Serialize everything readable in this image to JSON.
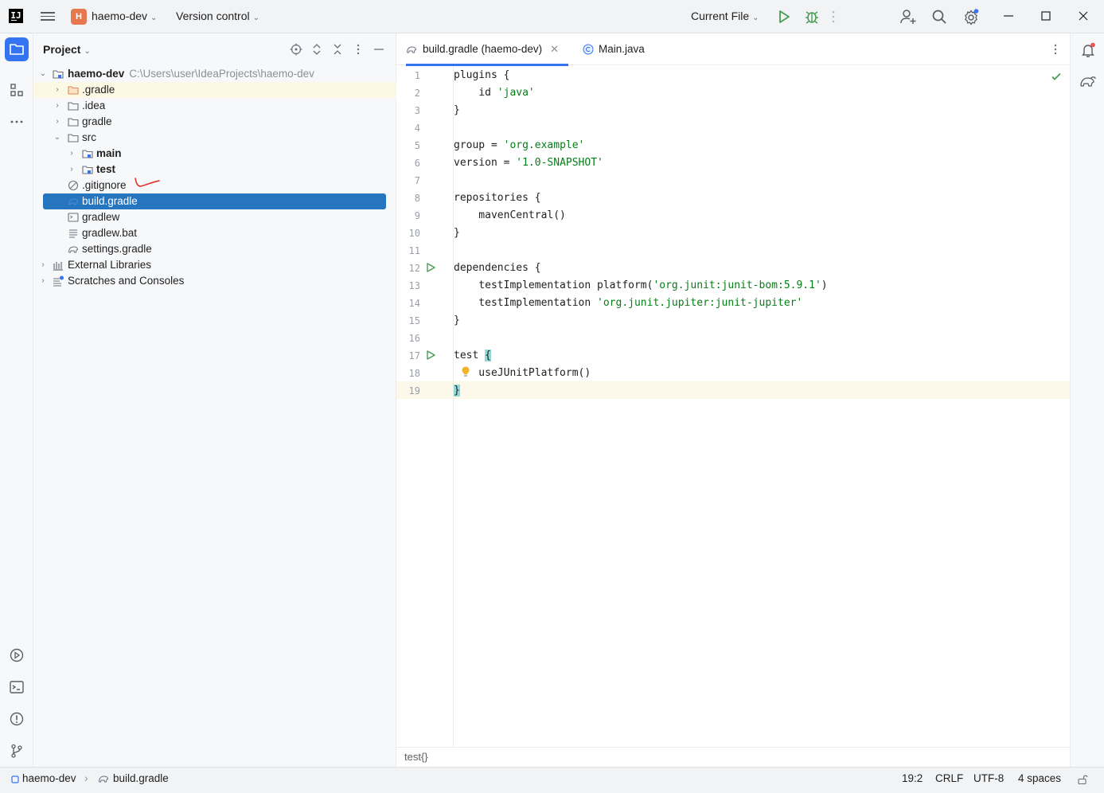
{
  "titlebar": {
    "project_initial": "H",
    "project_name": "haemo-dev",
    "vcs_label": "Version control",
    "run_config": "Current File"
  },
  "project_panel": {
    "title": "Project",
    "tree": [
      {
        "label": "haemo-dev",
        "path": "C:\\Users\\user\\IdeaProjects\\haemo-dev"
      },
      {
        "label": ".gradle"
      },
      {
        "label": ".idea"
      },
      {
        "label": "gradle"
      },
      {
        "label": "src"
      },
      {
        "label": "main"
      },
      {
        "label": "test"
      },
      {
        "label": ".gitignore"
      },
      {
        "label": "build.gradle"
      },
      {
        "label": "gradlew"
      },
      {
        "label": "gradlew.bat"
      },
      {
        "label": "settings.gradle"
      },
      {
        "label": "External Libraries"
      },
      {
        "label": "Scratches and Consoles"
      }
    ]
  },
  "editor": {
    "tabs": [
      {
        "label": "build.gradle (haemo-dev)"
      },
      {
        "label": "Main.java"
      }
    ],
    "line_numbers": [
      "1",
      "2",
      "3",
      "4",
      "5",
      "6",
      "7",
      "8",
      "9",
      "10",
      "11",
      "12",
      "13",
      "14",
      "15",
      "16",
      "17",
      "18",
      "19"
    ],
    "code": {
      "l1": "plugins {",
      "l2a": "    id ",
      "l2b": "'java'",
      "l3": "}",
      "l5a": "group = ",
      "l5b": "'org.example'",
      "l6a": "version = ",
      "l6b": "'1.0-SNAPSHOT'",
      "l8": "repositories {",
      "l9": "    mavenCentral()",
      "l10": "}",
      "l12": "dependencies {",
      "l13a": "    testImplementation platform(",
      "l13b": "'org.junit:junit-bom:5.9.1'",
      "l13c": ")",
      "l14a": "    testImplementation ",
      "l14b": "'org.junit.jupiter:junit-jupiter'",
      "l15": "}",
      "l17a": "test ",
      "l17b": "{",
      "l18": "    useJUnitPlatform()",
      "l19": "}"
    },
    "breadcrumb": "test{}"
  },
  "statusbar": {
    "crumb_project": "haemo-dev",
    "crumb_file": "build.gradle",
    "position": "19:2",
    "line_sep": "CRLF",
    "encoding": "UTF-8",
    "indent": "4 spaces"
  },
  "colors": {
    "accent": "#3574f0",
    "selection": "#2675bf",
    "string": "#067d17",
    "run_green": "#499c54",
    "badge": "#e5784f"
  }
}
